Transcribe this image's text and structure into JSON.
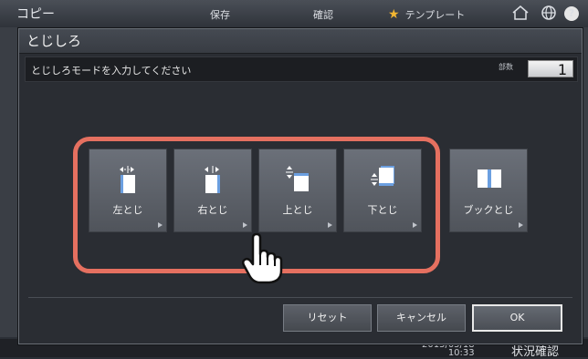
{
  "topbar": {
    "title": "コピー",
    "save_label": "保存",
    "confirm_label": "確認",
    "template_label": "テンプレート",
    "help_label": "?"
  },
  "dialog": {
    "title": "とじしろ",
    "instruction": "とじしろモードを入力してください",
    "copies_label": "部数",
    "copies_value": "1"
  },
  "binding_options": [
    {
      "label": "左とじ",
      "icon": "left-binding-icon"
    },
    {
      "label": "右とじ",
      "icon": "right-binding-icon"
    },
    {
      "label": "上とじ",
      "icon": "top-binding-icon"
    },
    {
      "label": "下とじ",
      "icon": "bottom-binding-icon"
    },
    {
      "label": "ブックとじ",
      "icon": "book-binding-icon"
    }
  ],
  "actions": {
    "reset_label": "リセット",
    "cancel_label": "キャンセル",
    "ok_label": "OK"
  },
  "statusbar": {
    "date": "2015/05/18",
    "time": "10:33",
    "status_label": "状況確認"
  },
  "colors": {
    "highlight": "#e57060",
    "star": "#f2b632",
    "page_blue": "#6b9fe0"
  }
}
